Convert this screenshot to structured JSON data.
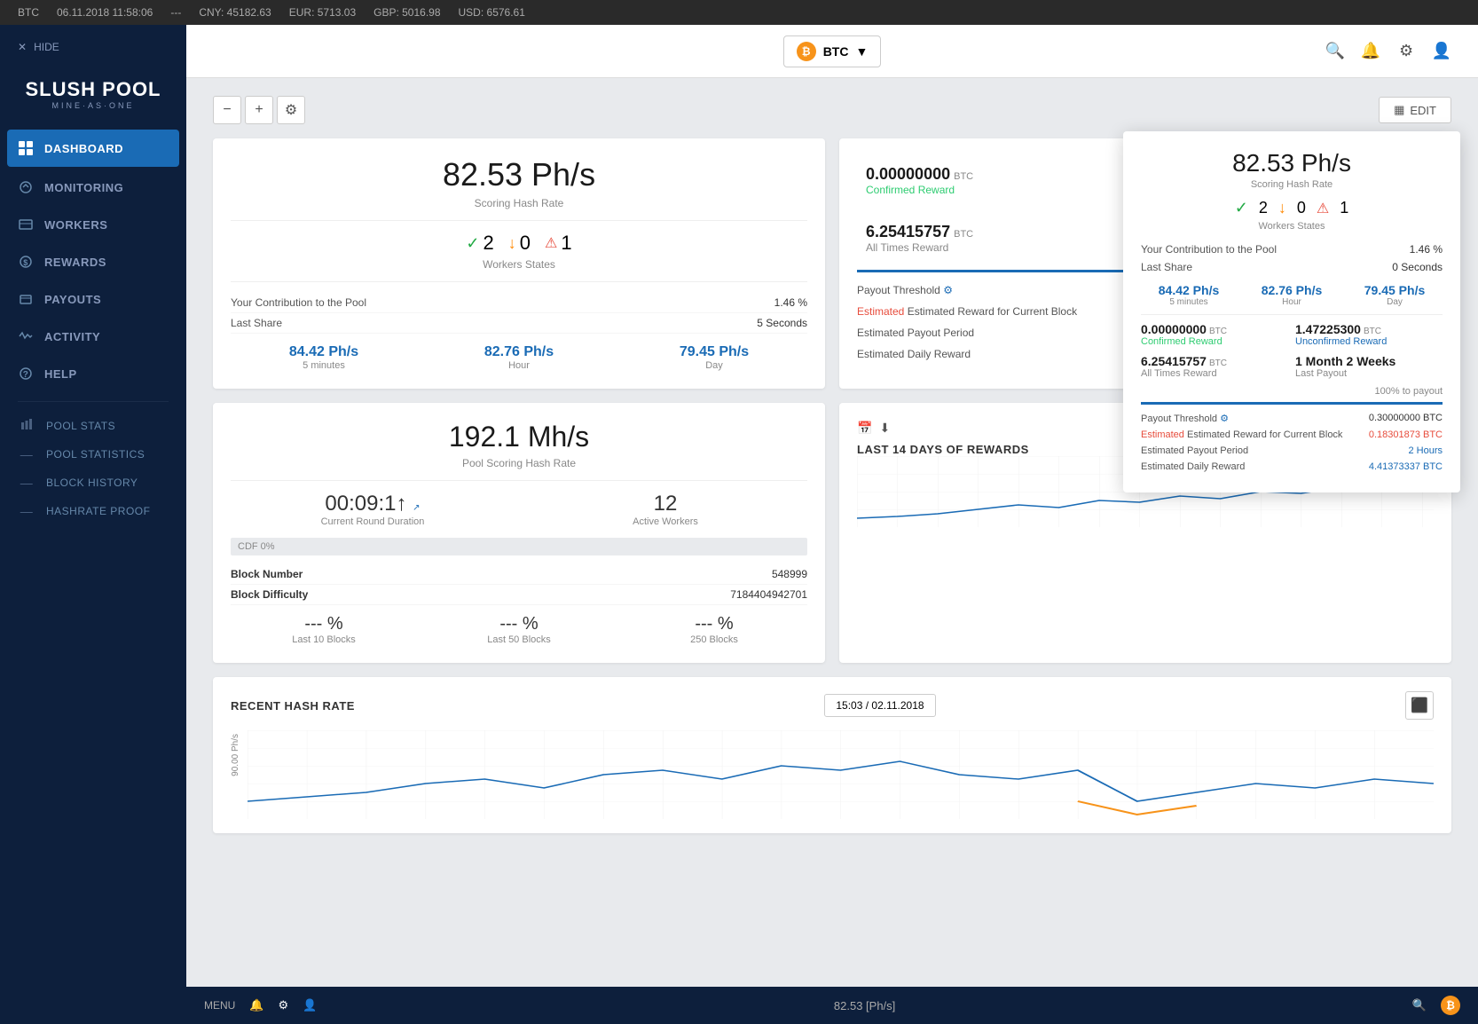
{
  "ticker": {
    "btc_label": "BTC",
    "date": "06.11.2018 11:58:06",
    "separator": "---",
    "cny": "CNY: 45182.63",
    "eur": "EUR: 5713.03",
    "gbp": "GBP: 5016.98",
    "usd": "USD: 6576.61"
  },
  "sidebar": {
    "hide_label": "HIDE",
    "logo": "SLUSH POOL",
    "logo_sub": "MINE·AS·ONE",
    "nav": [
      {
        "id": "dashboard",
        "label": "DASHBOARD",
        "active": true
      },
      {
        "id": "monitoring",
        "label": "MONITORING",
        "active": false
      },
      {
        "id": "workers",
        "label": "WORKERS",
        "active": false
      },
      {
        "id": "rewards",
        "label": "REWARDS",
        "active": false
      },
      {
        "id": "payouts",
        "label": "PAYOUTS",
        "active": false
      },
      {
        "id": "activity",
        "label": "ACTIVITY",
        "active": false
      },
      {
        "id": "help",
        "label": "HELP",
        "active": false
      }
    ],
    "pool_section": [
      {
        "id": "pool-stats",
        "label": "POOL STATS"
      },
      {
        "id": "pool-statistics",
        "label": "POOL STATISTICS"
      },
      {
        "id": "block-history",
        "label": "BLOCK HISTORY"
      },
      {
        "id": "hashrate-proof",
        "label": "HASHRATE PROOF"
      }
    ]
  },
  "header": {
    "btc_label": "BTC",
    "btc_symbol": "₿"
  },
  "toolbar": {
    "minus_label": "−",
    "plus_label": "+",
    "settings_label": "⚙",
    "edit_label": "EDIT"
  },
  "mining_card": {
    "hashrate": "82.53 Ph/s",
    "hashrate_label": "Scoring Hash Rate",
    "workers_ok": "2",
    "workers_down": "0",
    "workers_warn": "1",
    "workers_label": "Workers States",
    "contribution_label": "Your Contribution to the Pool",
    "contribution_value": "1.46 %",
    "last_share_label": "Last Share",
    "last_share_value": "5 Seconds",
    "hash_5min": "84.42 Ph/s",
    "hash_5min_label": "5 minutes",
    "hash_hour": "82.76 Ph/s",
    "hash_hour_label": "Hour",
    "hash_day": "79.45 Ph/s",
    "hash_day_label": "Day"
  },
  "reward_card": {
    "confirmed_value": "0.00000000",
    "confirmed_btc": "BTC",
    "confirmed_label": "Confirmed Reward",
    "unconfirmed_value": "1.47225300",
    "unconfirmed_btc": "BTC",
    "unconfirmed_label": "Unconfirmed Reward",
    "all_times_value": "6.25415757",
    "all_times_btc": "BTC",
    "all_times_label": "All Times Reward",
    "last_payout": "1 Month 2 Weeks",
    "last_payout_label": "Last Payout",
    "payout_threshold_label": "Payout Threshold",
    "estimated_reward_label": "Estimated Reward for Current Block",
    "estimated_payout_label": "Estimated Payout Period",
    "estimated_daily_label": "Estimated Daily Reward"
  },
  "pool_card": {
    "hashrate": "192.1 Mh/s",
    "hashrate_label": "Pool Scoring Hash Rate",
    "round_duration": "00:09:1↑",
    "round_duration_label": "Current Round Duration",
    "active_workers": "12",
    "active_workers_label": "Active Workers",
    "cdf_label": "CDF 0%",
    "block_number_label": "Block Number",
    "block_number_value": "548999",
    "block_difficulty_label": "Block Difficulty",
    "block_difficulty_value": "7184404942701",
    "pct_10_value": "--- %",
    "pct_10_label": "Last 10 Blocks",
    "pct_50_value": "--- %",
    "pct_50_label": "Last 50 Blocks",
    "pct_250_value": "--- %",
    "pct_250_label": "250 Blocks"
  },
  "rewards_chart": {
    "title": "Last 14 days of rewards"
  },
  "recent_hashrate": {
    "title": "RECENT HASH RATE",
    "date": "15:03 / 02.11.2018",
    "y_label": "90.00 Ph/s"
  },
  "popup": {
    "hashrate": "82.53 Ph/s",
    "hashrate_label": "Scoring Hash Rate",
    "workers_ok": "2",
    "workers_down": "0",
    "workers_warn": "1",
    "workers_label": "Workers States",
    "contribution_label": "Your Contribution to the Pool",
    "contribution_value": "1.46 %",
    "last_share_label": "Last Share",
    "last_share_value": "0 Seconds",
    "hash_5min": "84.42 Ph/s",
    "hash_5min_label": "5 minutes",
    "hash_hour": "82.76 Ph/s",
    "hash_hour_label": "Hour",
    "hash_day": "79.45 Ph/s",
    "hash_day_label": "Day",
    "confirmed_value": "0.00000000",
    "confirmed_btc": "BTC",
    "confirmed_label": "Confirmed Reward",
    "unconfirmed_value": "1.47225300",
    "unconfirmed_btc": "BTC",
    "unconfirmed_label": "Unconfirmed Reward",
    "all_times_value": "6.25415757",
    "all_times_btc": "BTC",
    "all_times_label": "All Times Reward",
    "last_payout": "1 Month 2 Weeks",
    "last_payout_label": "Last Payout",
    "payout_pct": "100% to payout",
    "payout_threshold_label": "Payout Threshold",
    "payout_threshold_value": "0.30000000 BTC",
    "estimated_reward_label": "Estimated Reward for Current Block",
    "estimated_reward_value": "0.18301873 BTC",
    "estimated_payout_label": "Estimated Payout Period",
    "estimated_payout_value": "2 Hours",
    "estimated_daily_label": "Estimated Daily Reward",
    "estimated_daily_value": "4.41373337 BTC"
  },
  "mobile_footer": {
    "menu_label": "MENU",
    "hashrate": "82.53 [Ph/s]"
  }
}
